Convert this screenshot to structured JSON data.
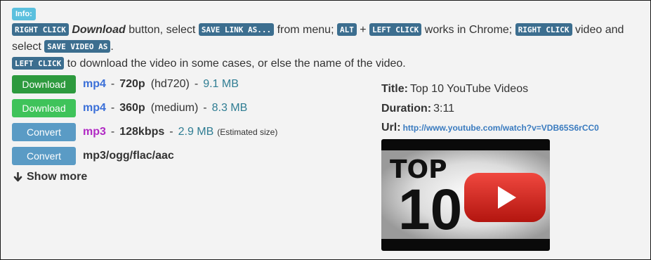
{
  "info": {
    "badge": "Info:"
  },
  "instructions": {
    "kbd_right_click_1": "RIGHT CLICK",
    "italic_download": "Download",
    "text_button_select": " button, select ",
    "kbd_save_link_as": "SAVE LINK AS...",
    "text_from_menu": " from menu; ",
    "kbd_alt": "ALT",
    "text_plus": " + ",
    "kbd_left_click_1": "LEFT CLICK",
    "text_works_in_chrome": " works in Chrome; ",
    "kbd_right_click_2": "RIGHT CLICK",
    "text_video_and_select": " video and select ",
    "kbd_save_video_as": "SAVE VIDEO AS",
    "text_period": ".",
    "kbd_left_click_2": "LEFT CLICK",
    "text_last": " to download the video in some cases, or else the name of the video."
  },
  "downloads": [
    {
      "button": "Download",
      "format": "mp4",
      "dash1": "-",
      "quality": "720p",
      "note": "(hd720)",
      "dash2": "-",
      "size": "9.1 MB"
    },
    {
      "button": "Download",
      "format": "mp4",
      "dash1": "-",
      "quality": "360p",
      "note": "(medium)",
      "dash2": "-",
      "size": "8.3 MB"
    },
    {
      "button": "Convert",
      "format": "mp3",
      "dash1": "-",
      "quality": "128kbps",
      "dash2": "-",
      "size": "2.9 MB",
      "size_note": "(Estimated size)"
    },
    {
      "button": "Convert",
      "format": "mp3/ogg/flac/aac"
    }
  ],
  "show_more": {
    "icon": "arrow-down-icon",
    "label": "Show more"
  },
  "meta": {
    "title_label": "Title:",
    "title_value": "Top 10 YouTube Videos",
    "duration_label": "Duration:",
    "duration_value": "3:11",
    "url_label": "Url:",
    "url_value": "http://www.youtube.com/watch?v=VDB65S6rCC0"
  },
  "thumbnail": {
    "text_top": "TOP",
    "text_ten": "10",
    "play_icon": "youtube-play-icon"
  },
  "colors": {
    "panel_bg": "#f3f3f3",
    "info_badge": "#5bc0de",
    "kbd_bg": "#3c6e8f",
    "button_download_dark": "#2d9a3e",
    "button_download_light": "#3fc35a",
    "button_convert": "#5a9bc5",
    "format_mp4": "#3a6fd8",
    "format_mp3": "#b12ac4",
    "size_text": "#2f7d93",
    "link": "#3a7bbf",
    "youtube_red": "#e12a27"
  }
}
